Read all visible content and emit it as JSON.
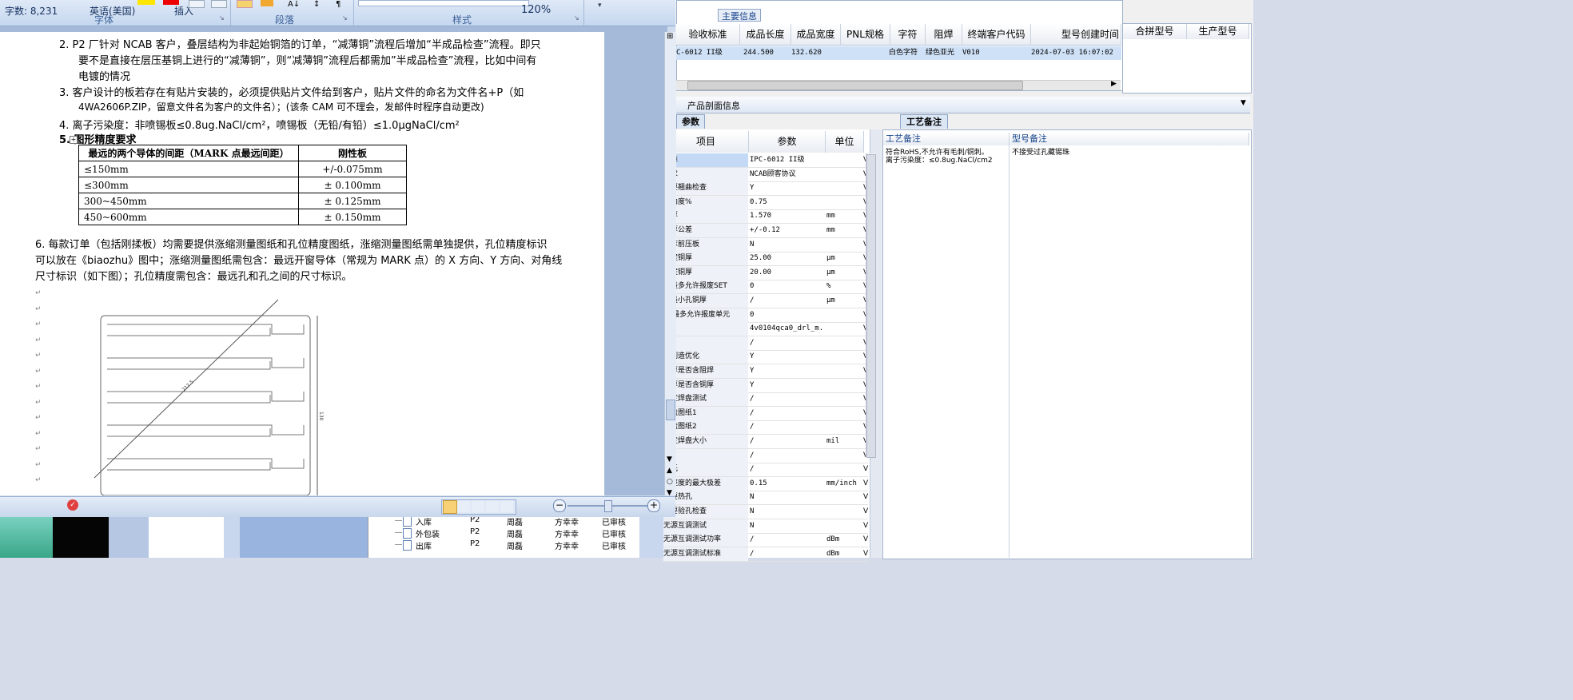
{
  "word": {
    "ribbon": {
      "font_group": "字体",
      "paragraph_group": "段落",
      "style_group": "样式"
    },
    "doc": {
      "p2_line1": "2.   P2 厂针对 NCAB 客户，叠层结构为非起始铜箔的订单，“减薄铜”流程后增加“半成品检查”流程。即只",
      "p2_line2": "要不是直接在层压基铜上进行的“减薄铜”，则“减薄铜”流程后都需加”半成品检查”流程，比如中间有",
      "p2_line3": "电镀的情况",
      "p3_line1": "3.   客户设计的板若存在有贴片安装的，必须提供贴片文件给到客户，贴片文件的命名为文件名+P（如",
      "p3_line2": "4WA2606P.ZIP，留意文件名为客户的文件名）；(该条 CAM 可不理会，发邮件时程序自动更改)",
      "p4": "4.   离子污染度：非喷锡板≤0.8ug.NaCl/cm²，喷锡板（无铅/有铅）≤1.0μgNaCl/cm²",
      "p5": "5.  图形精度要求",
      "table_header": [
        "最远的两个导体的间距（MARK 点最远间距）",
        "刚性板"
      ],
      "table_rows": [
        [
          "≤150mm",
          "+/-0.075mm"
        ],
        [
          "≤300mm",
          "± 0.100mm"
        ],
        [
          "300~450mm",
          "± 0.125mm"
        ],
        [
          "450~600mm",
          "± 0.150mm"
        ]
      ],
      "p6_line1": "6.  每款订单（包括刚揉板）均需要提供涨缩测量图纸和孔位精度图纸，涨缩测量图纸需单独提供，孔位精度标识",
      "p6_line2": "可以放在《biaozhu》图中；涨缩测量图纸需包含：最远开窗导体（常规为 MARK 点）的 X 方向、Y 方向、对角线",
      "p6_line3": "尺寸标识（如下图）；孔位精度需包含：最远孔和孔之间的尺寸标识。",
      "drawing_dim_diag": "212.5",
      "drawing_dim_side": "130"
    },
    "status": {
      "word_count": "字数: 8,231",
      "language": "英语(美国)",
      "insert_mode": "插入",
      "zoom": "120%"
    }
  },
  "erp": {
    "group_title": "主要信息",
    "main_columns": [
      "验收标准",
      "成品长度",
      "成品宽度",
      "PNL规格",
      "字符",
      "阻焊",
      "终端客户代码",
      "型号创建时间"
    ],
    "main_row": [
      "C-6012 II级",
      "244.500",
      "132.620",
      "",
      "白色字符",
      "绿色亚光",
      "V010",
      "2024-07-03 16:07:02"
    ],
    "right_columns": [
      "合拼型号",
      "生产型号"
    ],
    "section_title": "产品剖面信息",
    "param_tab": "参数",
    "param_columns": [
      "项目",
      "参数",
      "单位"
    ],
    "params": [
      [
        "标准",
        "IPC-6012 II级",
        "",
        "V"
      ],
      [
        "要求",
        "NCAB顾客协议",
        "",
        "V"
      ],
      [
        "需要翘曲检查",
        "Y",
        "",
        "V"
      ],
      [
        "翘曲度%",
        "0.75",
        "",
        "V"
      ],
      [
        "板厚",
        "1.570",
        "mm",
        "V"
      ],
      [
        "板厚公差",
        "+/-0.12",
        "mm",
        "V"
      ],
      [
        "入库前压板",
        "N",
        "",
        "V"
      ],
      [
        "孔壁铜厚",
        "25.00",
        "μm",
        "V"
      ],
      [
        "孔壁铜厚",
        "20.00",
        "μm",
        "V"
      ],
      [
        "次最多允许报废SET",
        "0",
        "%",
        "V"
      ],
      [
        "孔最小孔铜厚",
        "/",
        "μm",
        "V"
      ],
      [
        "ET最多允许报废单元",
        "0",
        "",
        "V"
      ],
      [
        "图1",
        "4v0104qca0_drl_m...",
        "",
        "V"
      ],
      [
        "图2",
        "/",
        "",
        "V"
      ],
      [
        "可制造优化",
        "Y",
        "",
        "V"
      ],
      [
        "板厚是否含阻焊",
        "Y",
        "",
        "V"
      ],
      [
        "板厚是否含铜厚",
        "Y",
        "",
        "V"
      ],
      [
        "邦定焊盘测试",
        "/",
        "",
        "V"
      ],
      [
        "焊盘图纸1",
        "/",
        "",
        "V"
      ],
      [
        "焊盘图纸2",
        "/",
        "",
        "V"
      ],
      [
        "邦定焊盘大小",
        "/",
        "mil",
        "V"
      ],
      [
        "面",
        "/",
        "",
        "V"
      ],
      [
        "图纸",
        "/",
        "",
        "V"
      ],
      [
        "平整度的最大极差",
        "0.15",
        "mm/inch",
        "V"
      ],
      [
        "需要热孔",
        "N",
        "",
        "V"
      ],
      [
        "需要验孔检查",
        "N",
        "",
        "V"
      ],
      [
        "无源互调测试",
        "N",
        "",
        "V"
      ],
      [
        "无源互调测试功率",
        "/",
        "dBm",
        "V"
      ],
      [
        "无源互调测试标准",
        "/",
        "dBm",
        "V"
      ]
    ],
    "craft_tab": "工艺备注",
    "craft_col1": "工艺备注",
    "craft_col2": "型号备注",
    "craft_note_line1": "符合RoHS,不允许有毛刺/铜刺。",
    "craft_note_line2": "离子污染度：≤0.8ug.NaCl/cm2",
    "model_note": "不接受过孔藏锡珠"
  },
  "taskbar_list": [
    [
      "入库",
      "P2",
      "周磊",
      "方幸幸",
      "已审核"
    ],
    [
      "外包装",
      "P2",
      "周磊",
      "方幸幸",
      "已审核"
    ],
    [
      "出库",
      "P2",
      "周磊",
      "方幸幸",
      "已审核"
    ]
  ]
}
